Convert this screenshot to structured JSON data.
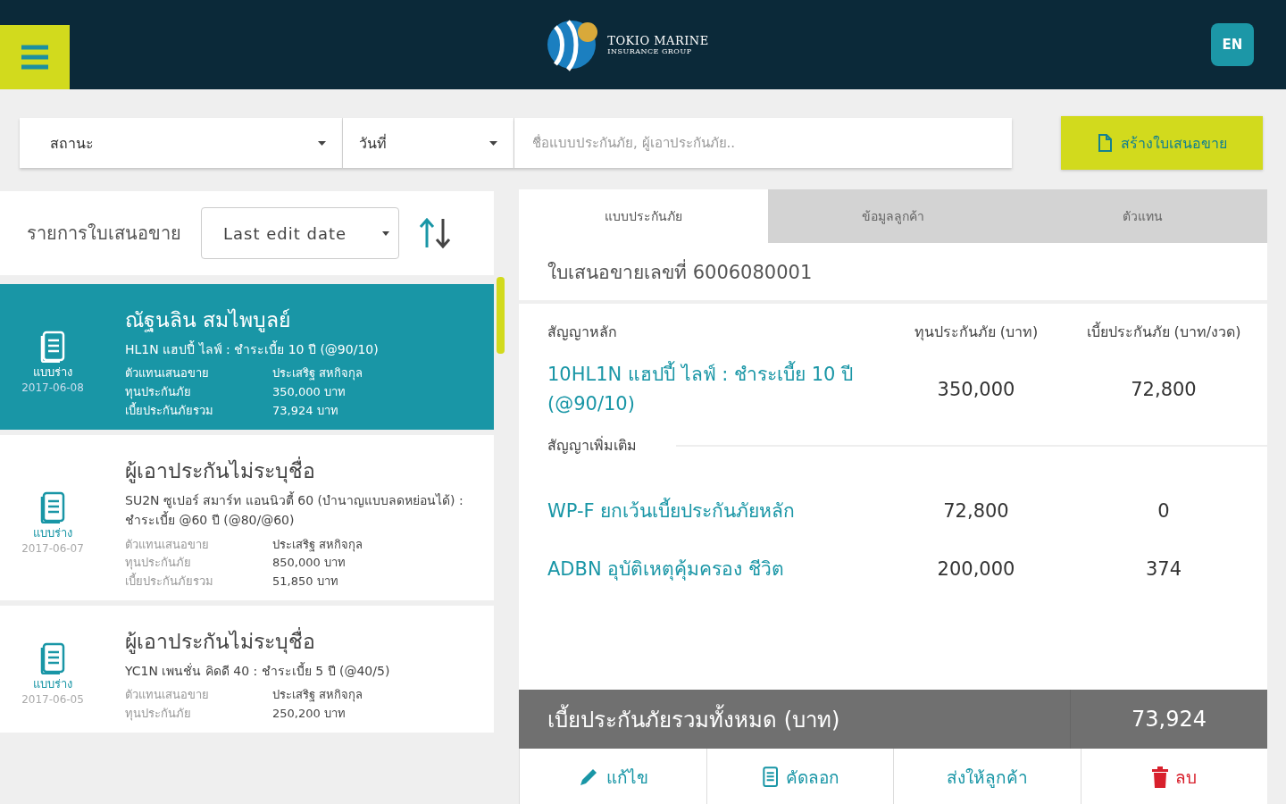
{
  "header": {
    "logo_line_1": "TOKIO MARINE",
    "logo_line_2": "INSURANCE GROUP",
    "language": "EN"
  },
  "filters": {
    "status": "สถานะ",
    "date": "วันที่",
    "search_placeholder": "ชื่อแบบประกันภัย, ผู้เอาประกันภัย..",
    "create_button": "สร้างใบเสนอขาย"
  },
  "list": {
    "title": "รายการใบเสนอขาย",
    "sort": "Last edit date",
    "items": [
      {
        "selected": true,
        "name": "ณัฐนลิน สมไพบูลย์",
        "plan": "HL1N แฮปปี้ ไลฟ์ : ชำระเบี้ย 10 ปี (@90/10)",
        "status": "แบบร่าง",
        "date": "2017-06-08",
        "details": [
          {
            "label": "ตัวแทนเสนอขาย",
            "value": "ประเสริฐ สหกิจกุล"
          },
          {
            "label": "ทุนประกันภัย",
            "value": "350,000 บาท"
          },
          {
            "label": "เบี้ยประกันภัยรวม",
            "value": "73,924 บาท"
          }
        ]
      },
      {
        "selected": false,
        "name": "ผู้เอาประกันไม่ระบุชื่อ",
        "plan": "SU2N ซูเปอร์ สมาร์ท แอนนิวตี้ 60 (บำนาญแบบลดหย่อนได้) : ชำระเบี้ย @60 ปี (@80/@60)",
        "status": "แบบร่าง",
        "date": "2017-06-07",
        "details": [
          {
            "label": "ตัวแทนเสนอขาย",
            "value": "ประเสริฐ สหกิจกุล"
          },
          {
            "label": "ทุนประกันภัย",
            "value": "850,000 บาท"
          },
          {
            "label": "เบี้ยประกันภัยรวม",
            "value": "51,850 บาท"
          }
        ]
      },
      {
        "selected": false,
        "name": "ผู้เอาประกันไม่ระบุชื่อ",
        "plan": "YC1N เพนชั่น คิดดี 40 : ชำระเบี้ย 5 ปี (@40/5)",
        "status": "แบบร่าง",
        "date": "2017-06-05",
        "details": [
          {
            "label": "ตัวแทนเสนอขาย",
            "value": "ประเสริฐ สหกิจกุล"
          },
          {
            "label": "ทุนประกันภัย",
            "value": "250,200 บาท"
          }
        ]
      }
    ]
  },
  "detail": {
    "tabs": [
      {
        "label": "แบบประกันภัย",
        "selected": true
      },
      {
        "label": "ข้อมูลลูกค้า",
        "selected": false
      },
      {
        "label": "ตัวแทน",
        "selected": false
      }
    ],
    "proposal_number": "ใบเสนอขายเลขที่ 6006080001",
    "main_contract": {
      "heading": "สัญญาหลัก",
      "columns": [
        "ทุนประกันภัย (บาท)",
        "เบี้ยประกันภัย (บาท/งวด)"
      ],
      "rows": [
        {
          "plan": "10HL1N แฮปปี้ ไลฟ์ : ชำระเบี้ย 10 ปี (@90/10)",
          "sum_insured": "350,000",
          "premium": "72,800"
        }
      ]
    },
    "riders": {
      "heading": "สัญญาเพิ่มเติม",
      "rows": [
        {
          "plan": "WP-F ยกเว้นเบี้ยประกันภัยหลัก",
          "sum_insured": "72,800",
          "premium": "0"
        },
        {
          "plan": "ADBN อุบัติเหตุคุ้มครอง ชีวิต",
          "sum_insured": "200,000",
          "premium": "374"
        }
      ]
    },
    "total": {
      "label": "เบี้ยประกันภัยรวมทั้งหมด (บาท)",
      "value": "73,924"
    },
    "actions": [
      {
        "kind": "edit",
        "label": "แก้ไข"
      },
      {
        "kind": "copy",
        "label": "คัดลอก"
      },
      {
        "kind": "send",
        "label": "ส่งให้ลูกค้า"
      },
      {
        "kind": "delete",
        "label": "ลบ"
      }
    ]
  }
}
